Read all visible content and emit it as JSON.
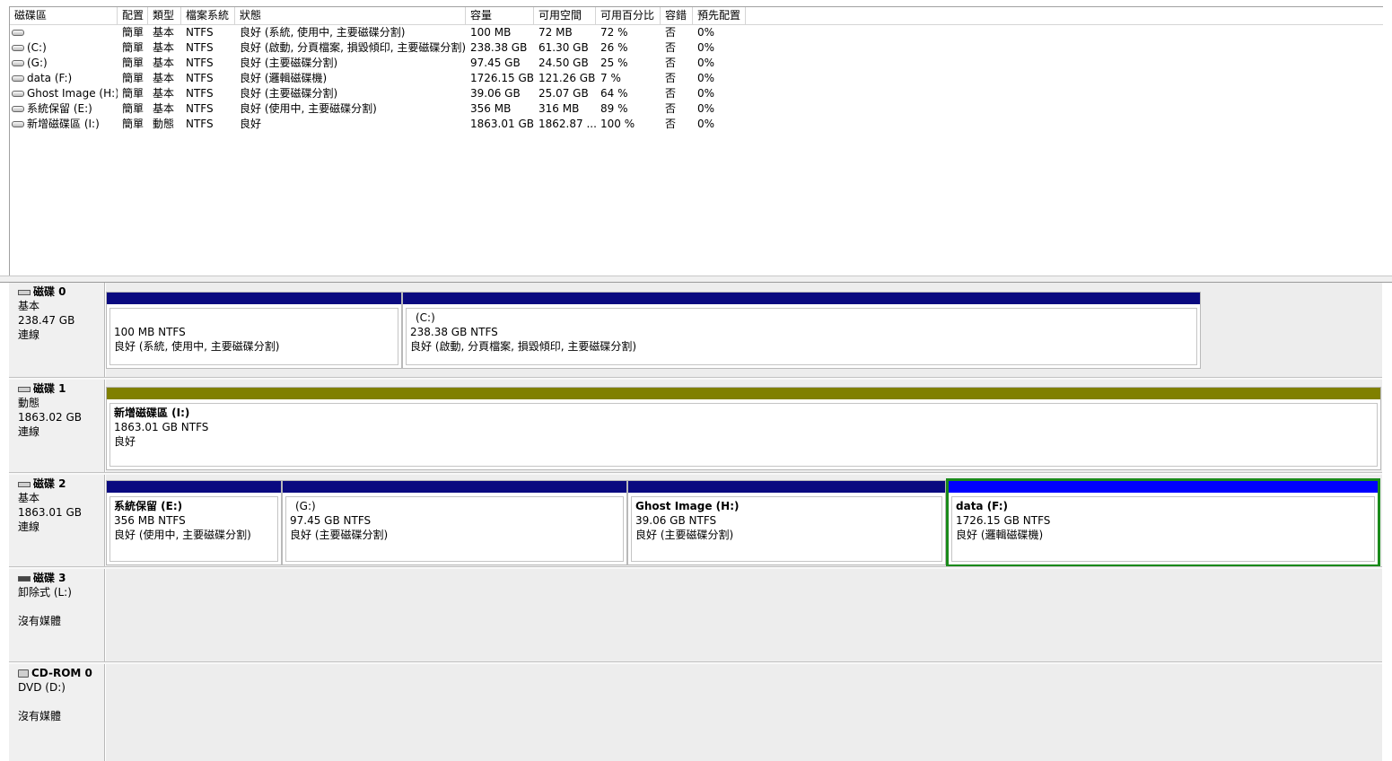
{
  "columns": [
    "磁碟區",
    "配置",
    "類型",
    "檔案系統",
    "狀態",
    "容量",
    "可用空間",
    "可用百分比",
    "容錯",
    "預先配置"
  ],
  "volumes": [
    {
      "name": "",
      "layout": "簡單",
      "type": "基本",
      "fs": "NTFS",
      "status": "良好 (系統, 使用中, 主要磁碟分割)",
      "capacity": "100 MB",
      "free": "72 MB",
      "pct": "72 %",
      "ft": "否",
      "overhead": "0%"
    },
    {
      "name": "(C:)",
      "layout": "簡單",
      "type": "基本",
      "fs": "NTFS",
      "status": "良好 (啟動, 分頁檔案, 損毀傾印, 主要磁碟分割)",
      "capacity": "238.38 GB",
      "free": "61.30 GB",
      "pct": "26 %",
      "ft": "否",
      "overhead": "0%"
    },
    {
      "name": "(G:)",
      "layout": "簡單",
      "type": "基本",
      "fs": "NTFS",
      "status": "良好 (主要磁碟分割)",
      "capacity": "97.45 GB",
      "free": "24.50 GB",
      "pct": "25 %",
      "ft": "否",
      "overhead": "0%"
    },
    {
      "name": "data (F:)",
      "layout": "簡單",
      "type": "基本",
      "fs": "NTFS",
      "status": "良好 (邏輯磁碟機)",
      "capacity": "1726.15 GB",
      "free": "121.26 GB",
      "pct": "7 %",
      "ft": "否",
      "overhead": "0%"
    },
    {
      "name": "Ghost Image (H:)",
      "layout": "簡單",
      "type": "基本",
      "fs": "NTFS",
      "status": "良好 (主要磁碟分割)",
      "capacity": "39.06 GB",
      "free": "25.07 GB",
      "pct": "64 %",
      "ft": "否",
      "overhead": "0%"
    },
    {
      "name": "系統保留 (E:)",
      "layout": "簡單",
      "type": "基本",
      "fs": "NTFS",
      "status": "良好 (使用中, 主要磁碟分割)",
      "capacity": "356 MB",
      "free": "316 MB",
      "pct": "89 %",
      "ft": "否",
      "overhead": "0%"
    },
    {
      "name": "新增磁碟區 (I:)",
      "layout": "簡單",
      "type": "動態",
      "fs": "NTFS",
      "status": "良好",
      "capacity": "1863.01 GB",
      "free": "1862.87 ...",
      "pct": "100 %",
      "ft": "否",
      "overhead": "0%"
    }
  ],
  "disks": [
    {
      "name": "磁碟 0",
      "type": "基本",
      "size": "238.47 GB",
      "state": "連線",
      "partitions": [
        {
          "title": "",
          "size": "100 MB NTFS",
          "status": "良好 (系統, 使用中, 主要磁碟分割)"
        },
        {
          "title": "(C:)",
          "size": "238.38 GB NTFS",
          "status": "良好 (啟動, 分頁檔案, 損毀傾印, 主要磁碟分割)"
        }
      ]
    },
    {
      "name": "磁碟 1",
      "type": "動態",
      "size": "1863.02 GB",
      "state": "連線",
      "partitions": [
        {
          "title": "新增磁碟區 (I:)",
          "size": "1863.01 GB NTFS",
          "status": "良好"
        }
      ]
    },
    {
      "name": "磁碟 2",
      "type": "基本",
      "size": "1863.01 GB",
      "state": "連線",
      "partitions": [
        {
          "title": "系統保留  (E:)",
          "size": "356 MB NTFS",
          "status": "良好 (使用中, 主要磁碟分割)"
        },
        {
          "title": "(G:)",
          "size": "97.45 GB NTFS",
          "status": "良好 (主要磁碟分割)"
        },
        {
          "title": "Ghost Image  (H:)",
          "size": "39.06 GB NTFS",
          "status": "良好 (主要磁碟分割)"
        },
        {
          "title": "data  (F:)",
          "size": "1726.15 GB NTFS",
          "status": "良好 (邏輯磁碟機)"
        }
      ]
    },
    {
      "name": "磁碟 3",
      "type": "卸除式 (L:)",
      "size": "",
      "state": "沒有媒體"
    },
    {
      "name": "CD-ROM 0",
      "type": "DVD (D:)",
      "size": "",
      "state": "沒有媒體"
    }
  ],
  "colors": {
    "primary_partition": "#0a0a80",
    "simple_volume": "#808000",
    "logical_drive": "#0000ff",
    "selection": "#1a8a1a"
  }
}
